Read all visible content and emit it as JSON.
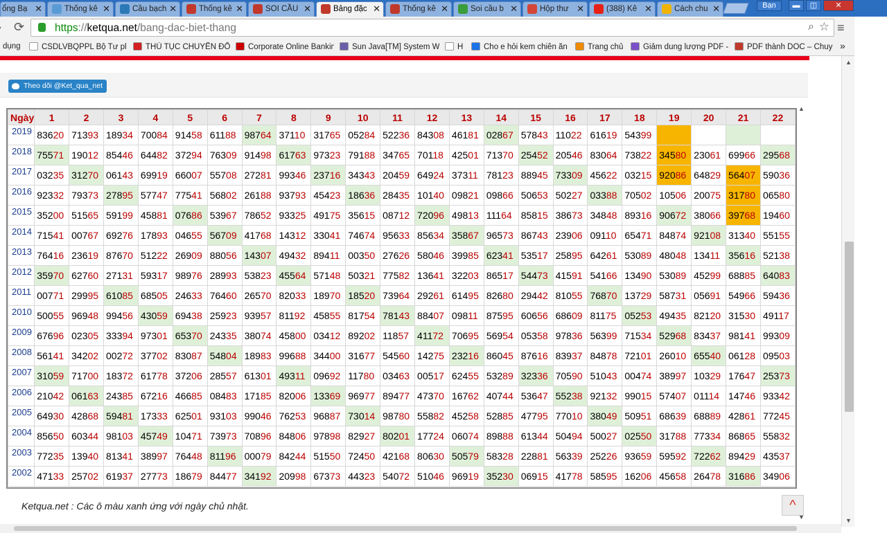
{
  "browser": {
    "tabs": [
      {
        "title": "ổng Bạ",
        "color": "#4f8fd6",
        "active": false
      },
      {
        "title": "Thống kê",
        "color": "#5b9bd5",
        "active": false
      },
      {
        "title": "Cầu bạch",
        "color": "#2b7ab7",
        "active": false
      },
      {
        "title": "Thống kê",
        "color": "#c0392b",
        "active": false
      },
      {
        "title": "SOI CẦU",
        "color": "#c0392b",
        "active": false
      },
      {
        "title": "Bảng đặc",
        "color": "#c0392b",
        "active": true
      },
      {
        "title": "Thống kê",
        "color": "#c0392b",
        "active": false
      },
      {
        "title": "Soi cầu b",
        "color": "#3a9c3a",
        "active": false
      },
      {
        "title": "Hộp thư",
        "color": "#d44638",
        "active": false
      },
      {
        "title": "(388) Kê",
        "color": "#e62117",
        "active": false
      },
      {
        "title": "Cách chu",
        "color": "#f0b400",
        "active": false
      }
    ],
    "close_glyph": "✕",
    "user_label": "Bạn",
    "window_controls": {
      "minimize": "▬",
      "restore": "◫",
      "close": "✕"
    },
    "url": {
      "scheme": "https",
      "separator": "://",
      "host": "ketqua.net",
      "path": "/bang-dac-biet-thang"
    },
    "nav_icons": {
      "back": "arrow-left-icon",
      "reload": "reload-icon",
      "zoom": "magnifier-icon",
      "star": "star-icon",
      "menu": "menu-icon"
    },
    "bookmarks": [
      {
        "label": "dụng",
        "icon": "none",
        "color": "#f2f2f2"
      },
      {
        "label": "CSDLVBQPPL Bộ Tư pháp",
        "icon": "page-icon",
        "color": "#ffffff"
      },
      {
        "label": "THỦ TỤC CHUYỂN ĐỔI",
        "icon": "emblem-icon",
        "color": "#d42020"
      },
      {
        "label": "Corporate Online Bankin",
        "icon": "bank-icon",
        "color": "#cc0000"
      },
      {
        "label": "Sun Java[TM] System W",
        "icon": "diamond-icon",
        "color": "#6b5fa8"
      },
      {
        "label": "H",
        "icon": "page-icon",
        "color": "#ffffff"
      },
      {
        "label": "Cho e hỏi kem chiên ăn",
        "icon": "check-icon",
        "color": "#1a73e8"
      },
      {
        "label": "Trang chủ",
        "icon": "star-icon",
        "color": "#f08a00"
      },
      {
        "label": "Giảm dung lượng PDF -",
        "icon": "grid-icon",
        "color": "#7b4fc9"
      },
      {
        "label": "PDF thành DOC – Chuyể",
        "icon": "pdf-icon",
        "color": "#c0392b"
      }
    ],
    "more_bookmarks": "»"
  },
  "page": {
    "follow_button": "Theo dõi @Ket_qua_net",
    "note": "Ketqua.net : Các ô màu xanh ứng với ngày chủ nhật.",
    "to_top_glyph": "^",
    "colors": {
      "sunday_green": "#dff0d8",
      "highlight_orange": "#f7b500",
      "last_two_red": "#b00000",
      "year_blue": "#1a3d8f"
    }
  },
  "table": {
    "corner_header": "Ngày",
    "columns": [
      "1",
      "2",
      "3",
      "4",
      "5",
      "6",
      "7",
      "8",
      "9",
      "10",
      "11",
      "12",
      "13",
      "14",
      "15",
      "16",
      "17",
      "18",
      "19",
      "20",
      "21",
      "22"
    ],
    "rows": [
      {
        "year": "2019",
        "cells": [
          "83620",
          "71393",
          "18934",
          "70084",
          "91458",
          "61188",
          "98764",
          "37110",
          "31765",
          "05284",
          "52236",
          "84308",
          "46181",
          "02867",
          "57843",
          "11022",
          "61619",
          "54399",
          "",
          "",
          "",
          ""
        ],
        "green": [
          7,
          14,
          21
        ],
        "orange": [
          19
        ]
      },
      {
        "year": "2018",
        "cells": [
          "75571",
          "19012",
          "85446",
          "64482",
          "37294",
          "76309",
          "91498",
          "61763",
          "97323",
          "79188",
          "34765",
          "70118",
          "42501",
          "71370",
          "25452",
          "20546",
          "83064",
          "73822",
          "34580",
          "23061",
          "69966",
          "29568"
        ],
        "green": [
          1,
          8,
          15,
          22
        ],
        "orange": [
          19
        ]
      },
      {
        "year": "2017",
        "cells": [
          "03235",
          "31270",
          "06143",
          "69919",
          "66007",
          "55708",
          "27281",
          "99346",
          "23716",
          "34343",
          "20459",
          "64924",
          "37311",
          "78123",
          "88945",
          "73309",
          "45622",
          "03215",
          "92086",
          "64829",
          "56407",
          "59036"
        ],
        "green": [
          2,
          9,
          16
        ],
        "orange": [
          19,
          21
        ]
      },
      {
        "year": "2016",
        "cells": [
          "92332",
          "79373",
          "27895",
          "57747",
          "77541",
          "56802",
          "26188",
          "93793",
          "45423",
          "18636",
          "28435",
          "10140",
          "09821",
          "09866",
          "50653",
          "50227",
          "03388",
          "70502",
          "10506",
          "20075",
          "31780",
          "06580"
        ],
        "green": [
          3,
          10,
          17
        ],
        "orange": [
          21
        ]
      },
      {
        "year": "2015",
        "cells": [
          "35200",
          "51565",
          "59199",
          "45881",
          "07686",
          "53967",
          "78652",
          "93325",
          "49175",
          "35615",
          "08712",
          "72096",
          "49813",
          "11164",
          "85815",
          "38673",
          "34848",
          "89316",
          "90672",
          "38066",
          "39768",
          "19460"
        ],
        "green": [
          5,
          12,
          19
        ],
        "orange": [
          21
        ]
      },
      {
        "year": "2014",
        "cells": [
          "71541",
          "00767",
          "69276",
          "17893",
          "04655",
          "56709",
          "41768",
          "14312",
          "33041",
          "74674",
          "95633",
          "85634",
          "35867",
          "96573",
          "86743",
          "23906",
          "09110",
          "65471",
          "84874",
          "92108",
          "31340",
          "55155"
        ],
        "green": [
          6,
          13,
          20
        ],
        "orange": []
      },
      {
        "year": "2013",
        "cells": [
          "76416",
          "23619",
          "87670",
          "51222",
          "26909",
          "88056",
          "14307",
          "49432",
          "89411",
          "00350",
          "27626",
          "58046",
          "39985",
          "62341",
          "53517",
          "25895",
          "64261",
          "53089",
          "48048",
          "13411",
          "35616",
          "52138"
        ],
        "green": [
          7,
          14,
          21
        ],
        "orange": []
      },
      {
        "year": "2012",
        "cells": [
          "35970",
          "62760",
          "27131",
          "59317",
          "98976",
          "28993",
          "53823",
          "45564",
          "57148",
          "50321",
          "77582",
          "13641",
          "32203",
          "86517",
          "54473",
          "41591",
          "54166",
          "13490",
          "53089",
          "45299",
          "68885",
          "64083"
        ],
        "green": [
          1,
          8,
          15,
          22
        ],
        "orange": []
      },
      {
        "year": "2011",
        "cells": [
          "00771",
          "29995",
          "61085",
          "68505",
          "24633",
          "76460",
          "26570",
          "82033",
          "18970",
          "18520",
          "73964",
          "29261",
          "61495",
          "82680",
          "29442",
          "81055",
          "76870",
          "13729",
          "58731",
          "05691",
          "54966",
          "59436"
        ],
        "green": [
          3,
          10,
          17
        ],
        "orange": []
      },
      {
        "year": "2010",
        "cells": [
          "50055",
          "96948",
          "99456",
          "43059",
          "69438",
          "25923",
          "93957",
          "81192",
          "45855",
          "81754",
          "78143",
          "88407",
          "09811",
          "87595",
          "60656",
          "68609",
          "81175",
          "05253",
          "49435",
          "82120",
          "31530",
          "49117"
        ],
        "green": [
          4,
          11,
          18
        ],
        "orange": []
      },
      {
        "year": "2009",
        "cells": [
          "67696",
          "02305",
          "33394",
          "97301",
          "65370",
          "24335",
          "38074",
          "45800",
          "03412",
          "89202",
          "11857",
          "41172",
          "70695",
          "56954",
          "05358",
          "97836",
          "56399",
          "71534",
          "52968",
          "83437",
          "98141",
          "99309"
        ],
        "green": [
          5,
          12,
          19
        ],
        "orange": []
      },
      {
        "year": "2008",
        "cells": [
          "56141",
          "34202",
          "00272",
          "37702",
          "83087",
          "54804",
          "18983",
          "99688",
          "34400",
          "31677",
          "54560",
          "14275",
          "23216",
          "86045",
          "87616",
          "83937",
          "84878",
          "72101",
          "26010",
          "65540",
          "06128",
          "09503"
        ],
        "green": [
          6,
          13,
          20
        ],
        "orange": []
      },
      {
        "year": "2007",
        "cells": [
          "31059",
          "71700",
          "18372",
          "61778",
          "37206",
          "28557",
          "61301",
          "49311",
          "09692",
          "11780",
          "03463",
          "00517",
          "62455",
          "53289",
          "32336",
          "70590",
          "51043",
          "00474",
          "38997",
          "10329",
          "17647",
          "25373"
        ],
        "green": [
          1,
          8,
          15,
          22
        ],
        "orange": []
      },
      {
        "year": "2006",
        "cells": [
          "21042",
          "06163",
          "24385",
          "67216",
          "46685",
          "08483",
          "17185",
          "82006",
          "13369",
          "96977",
          "89477",
          "47370",
          "16762",
          "40744",
          "53647",
          "55238",
          "92132",
          "99015",
          "57407",
          "01114",
          "14746",
          "93342"
        ],
        "green": [
          2,
          9,
          16
        ],
        "orange": []
      },
      {
        "year": "2005",
        "cells": [
          "64930",
          "42868",
          "59481",
          "17333",
          "62501",
          "93103",
          "99046",
          "76253",
          "96887",
          "73014",
          "98780",
          "55882",
          "45258",
          "52885",
          "47795",
          "77010",
          "38049",
          "50951",
          "68639",
          "68889",
          "42861",
          "77245"
        ],
        "green": [
          3,
          10,
          17
        ],
        "orange": []
      },
      {
        "year": "2004",
        "cells": [
          "85650",
          "60344",
          "98103",
          "45749",
          "10471",
          "73973",
          "70896",
          "84806",
          "97898",
          "82927",
          "80201",
          "17724",
          "06074",
          "89888",
          "61344",
          "50494",
          "50027",
          "02550",
          "31788",
          "77334",
          "86865",
          "55832"
        ],
        "green": [
          4,
          11,
          18
        ],
        "orange": []
      },
      {
        "year": "2003",
        "cells": [
          "77235",
          "13940",
          "81341",
          "38997",
          "76448",
          "81196",
          "00079",
          "84244",
          "51550",
          "72450",
          "42168",
          "80630",
          "50579",
          "58328",
          "22881",
          "56339",
          "25226",
          "93659",
          "59592",
          "72262",
          "89429",
          "43537"
        ],
        "green": [
          6,
          13,
          20
        ],
        "orange": []
      },
      {
        "year": "2002",
        "cells": [
          "47133",
          "25702",
          "61937",
          "27773",
          "18679",
          "84477",
          "34192",
          "20998",
          "67373",
          "44323",
          "54072",
          "51046",
          "96919",
          "35230",
          "06915",
          "41778",
          "58595",
          "16206",
          "45658",
          "26478",
          "31686",
          "34906"
        ],
        "green": [
          7,
          14,
          21
        ],
        "orange": []
      }
    ]
  }
}
